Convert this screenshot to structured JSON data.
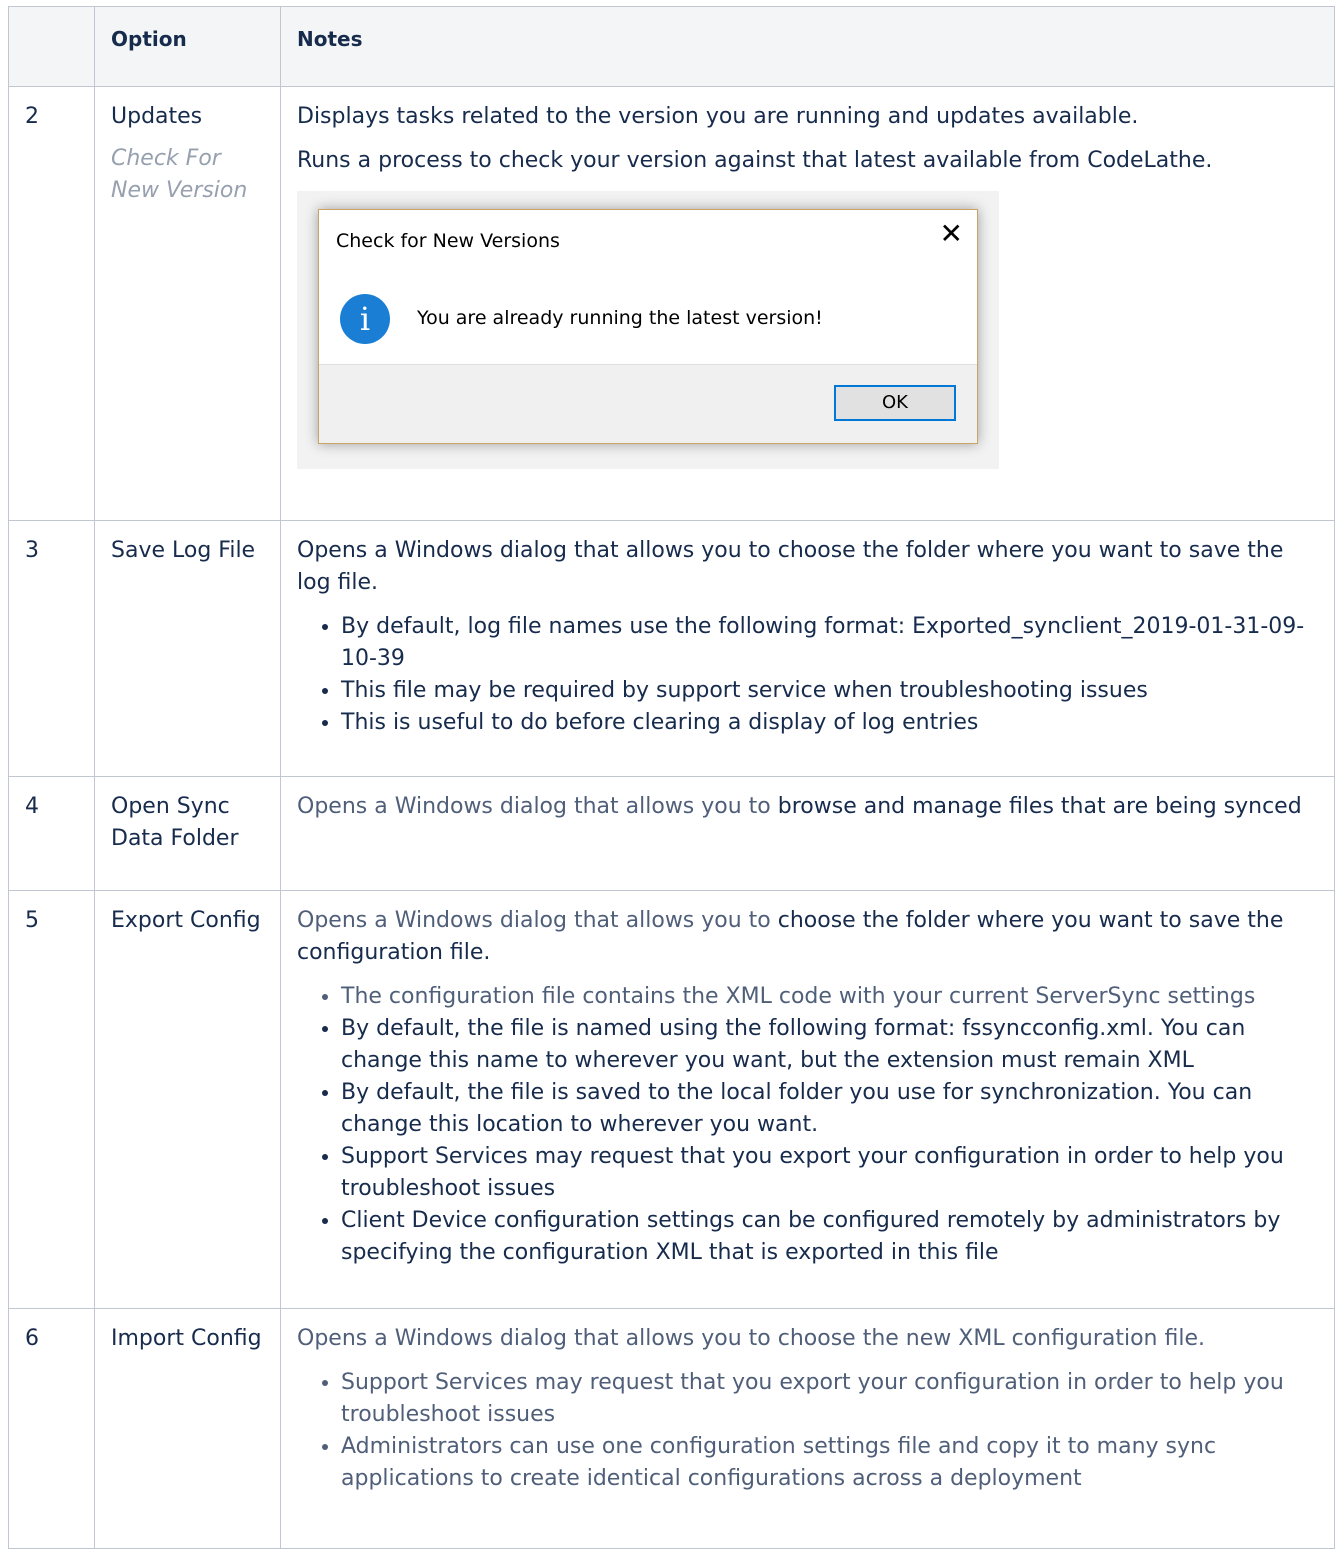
{
  "table": {
    "headers": [
      "",
      "Option",
      "Notes"
    ],
    "rows": [
      {
        "num": "2",
        "option": "Updates",
        "option_sub": "Check For New Version",
        "notes_p1": "Displays tasks related to the version you are running and updates available.",
        "notes_p2": "Runs a process to check your version against that latest available from CodeLathe.",
        "dialog": {
          "title": "Check for New Versions",
          "message": "You are already running the latest version!",
          "ok_label": "OK",
          "info_glyph": "i",
          "close_glyph": "✕",
          "icon": "info-icon"
        }
      },
      {
        "num": "3",
        "option": "Save Log File",
        "notes_p1": "Opens a Windows dialog that allows you to choose the folder where you want to save the log file.",
        "bullets": [
          "By default, log file names use the following format: Exported_synclient_2019-01-31-09-10-39",
          "This file may be required by support service when troubleshooting issues",
          "This is useful to do before clearing a display of log entries"
        ]
      },
      {
        "num": "4",
        "option": "Open Sync Data Folder",
        "notes_prefix": "Opens a Windows dialog that allows you to",
        "notes_rest": " browse and manage files that are being synced"
      },
      {
        "num": "5",
        "option": "Export Config",
        "notes_prefix": "Opens a Windows dialog that allows you to",
        "notes_rest": " choose the folder where you want to save the configuration file.",
        "bullets": [
          "The configuration file contains the XML code with your current ServerSync settings",
          "By default, the file is named using the following format: fssyncconfig.xml. You can change this name to wherever you want, but the extension must remain XML",
          "By default, the file is saved to the local folder you use for synchronization. You can change this location to wherever you want.",
          "Support Services may request that you export your configuration in order to help you troubleshoot issues",
          "Client Device configuration settings can be configured remotely by administrators by specifying the configuration XML that is exported in this file"
        ]
      },
      {
        "num": "6",
        "option": "Import Config",
        "notes_p1": "Opens a Windows dialog that allows you to choose the new XML configuration file.",
        "bullets": [
          "Support Services may request that you export your configuration in order to help you troubleshoot issues",
          "Administrators can use one configuration settings file and copy it to many sync applications to create identical configurations across a deployment"
        ]
      }
    ]
  },
  "colors": {
    "border": "#c1c7d0",
    "header_bg": "#f4f5f7",
    "text": "#172b4d",
    "muted": "#505f79",
    "dialog_accent": "#0078d7"
  }
}
